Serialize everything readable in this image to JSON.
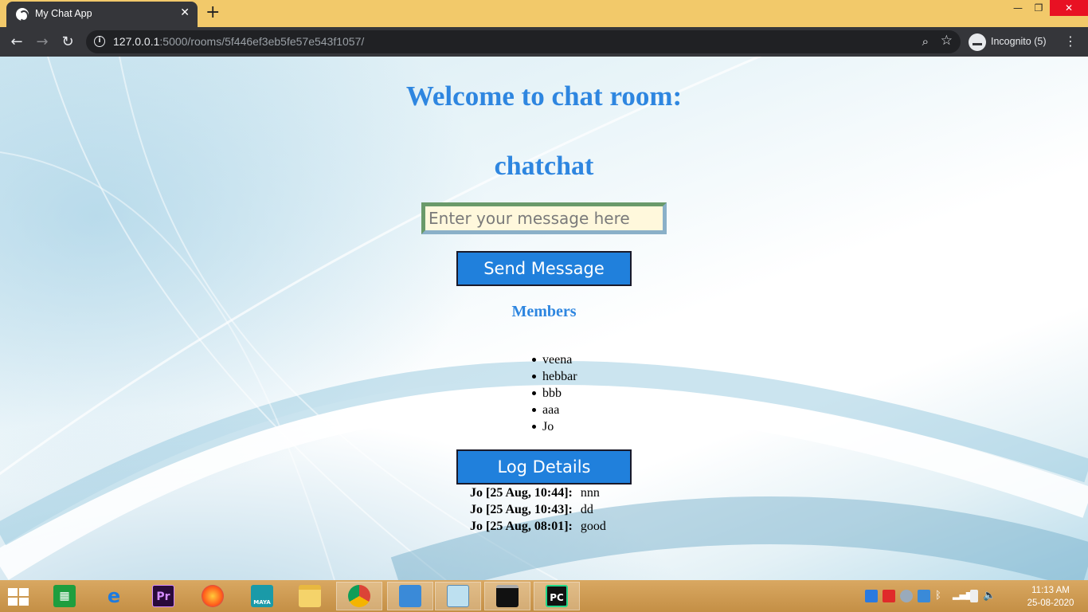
{
  "browser": {
    "tab_title": "My Chat App",
    "url_host": "127.0.0.1",
    "url_rest": ":5000/rooms/5f446ef3eb5fe57e543f1057/",
    "incognito_label": "Incognito (5)"
  },
  "page": {
    "welcome": "Welcome to chat room:",
    "room_name": "chatchat",
    "message_placeholder": "Enter your message here",
    "send_label": "Send Message",
    "members_heading": "Members",
    "members": [
      "veena",
      "hebbar",
      "bbb",
      "aaa",
      "Jo"
    ],
    "log_label": "Log Details",
    "log": [
      {
        "who": "Jo [25 Aug, 10:44]:",
        "text": "nnn"
      },
      {
        "who": "Jo [25 Aug, 10:43]:",
        "text": "dd"
      },
      {
        "who": "Jo [25 Aug, 08:01]:",
        "text": "good"
      }
    ]
  },
  "taskbar": {
    "apps": [
      "store",
      "internet-explorer",
      "premiere-pro",
      "firefox",
      "maya",
      "file-explorer",
      "chrome",
      "control-panel",
      "notepad",
      "command-prompt",
      "pycharm"
    ],
    "app_labels": {
      "premiere": "Pr",
      "maya": "MAYA",
      "pycharm": "PC"
    },
    "time": "11:13 AM",
    "date": "25-08-2020"
  },
  "colors": {
    "heading": "#2e86e0",
    "button": "#2080dc",
    "tab_strip": "#f2c96a",
    "toolbar": "#35363a"
  }
}
